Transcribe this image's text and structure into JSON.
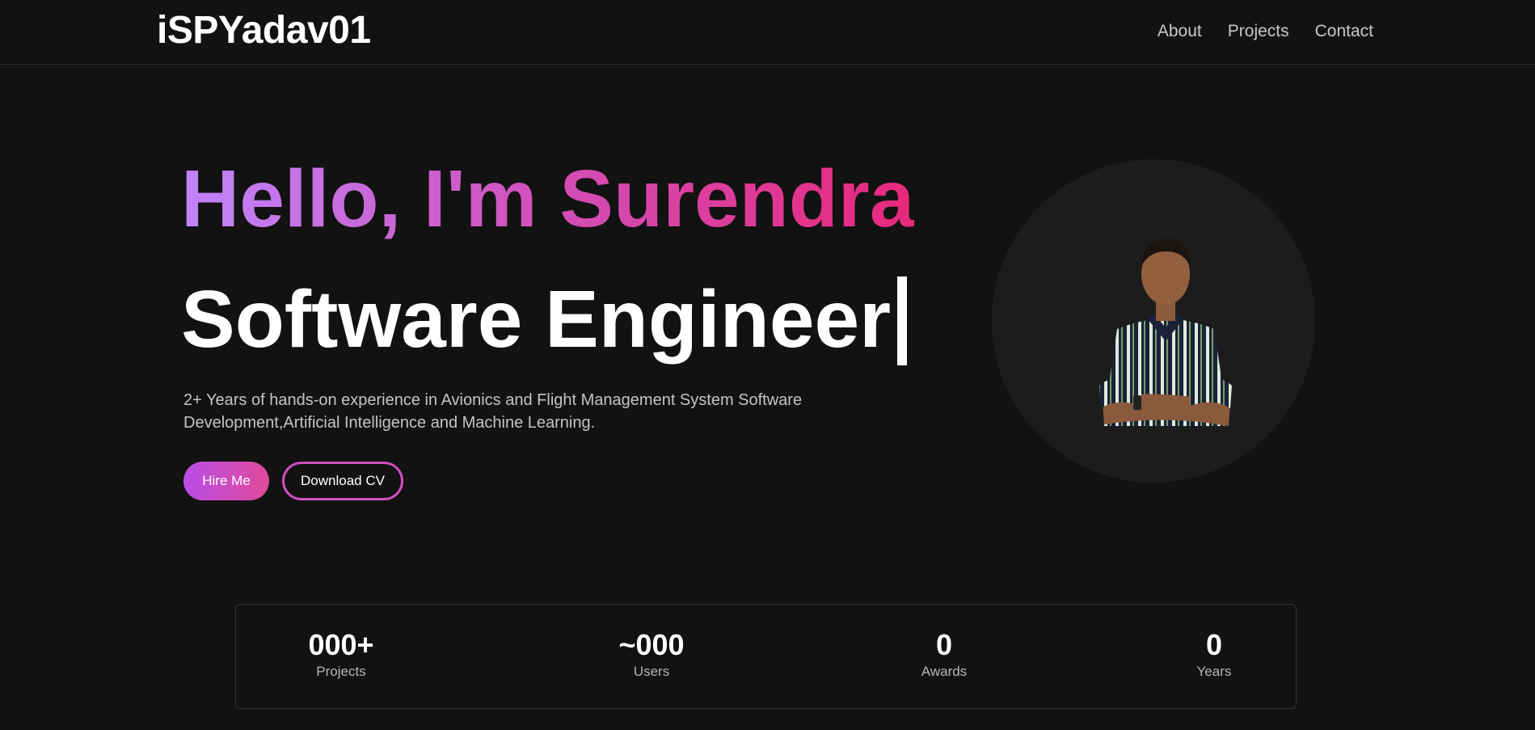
{
  "header": {
    "logo": "iSPYadav01",
    "nav": [
      "About",
      "Projects",
      "Contact"
    ]
  },
  "hero": {
    "greeting": "Hello, I'm Surendra",
    "role": "Software Engineer",
    "description": "2+ Years of hands-on experience in Avionics and Flight Management System Software Development,Artificial Intelligence and Machine Learning.",
    "hire_label": "Hire Me",
    "cv_label": "Download CV"
  },
  "stats": [
    {
      "value": "000+",
      "label": "Projects"
    },
    {
      "value": "~000",
      "label": "Users"
    },
    {
      "value": "0",
      "label": "Awards"
    },
    {
      "value": "0",
      "label": "Years"
    }
  ],
  "colors": {
    "background": "#121212",
    "gradient_start": "#c084fc",
    "gradient_end": "#e7287a",
    "button_border": "#d14ec0"
  }
}
